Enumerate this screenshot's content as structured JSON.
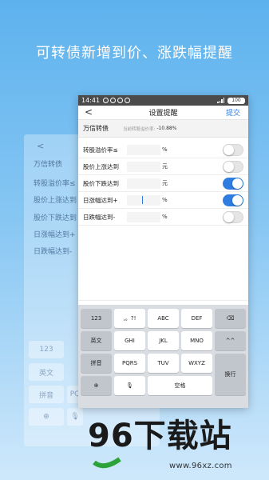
{
  "headline": "可转债新增到价、涨跌幅提醒",
  "ghost": {
    "back": "<",
    "items": [
      "万信转债",
      "转股溢价率≤",
      "股价上涨达到",
      "股价下跌达到",
      "日涨幅达到+",
      "日跌幅达到-"
    ],
    "keys": [
      "123",
      "英文",
      "拼音",
      "PQ"
    ]
  },
  "status": {
    "time": "14:41",
    "battery": "100"
  },
  "nav": {
    "back": "<",
    "title": "设置提醒",
    "submit": "提交"
  },
  "bond": {
    "name": "万信转债",
    "sub_label": "当前转股溢价率:",
    "sub_value": "-10.88%"
  },
  "settings": [
    {
      "label": "转股溢价率≤",
      "unit": "%",
      "enabled": false
    },
    {
      "label": "股价上涨达到",
      "unit": "元",
      "enabled": false
    },
    {
      "label": "股价下跌达到",
      "unit": "元",
      "enabled": true
    },
    {
      "label": "日涨幅达到+",
      "unit": "%",
      "enabled": true
    },
    {
      "label": "日跌幅达到-",
      "unit": "%",
      "enabled": false
    }
  ],
  "keyboard": {
    "k123": "123",
    "punct": ",。?!",
    "abc": "ABC",
    "def": "DEF",
    "english": "英文",
    "ghi": "GHI",
    "jkl": "JKL",
    "mno": "MNO",
    "emoji": "^^",
    "pinyin": "拼音",
    "pqrs": "PQRS",
    "tuv": "TUV",
    "wxyz": "WXYZ",
    "newline": "换行",
    "space": "空格"
  },
  "watermark": {
    "brand": "96下载站",
    "site": "www.96xz.com"
  }
}
